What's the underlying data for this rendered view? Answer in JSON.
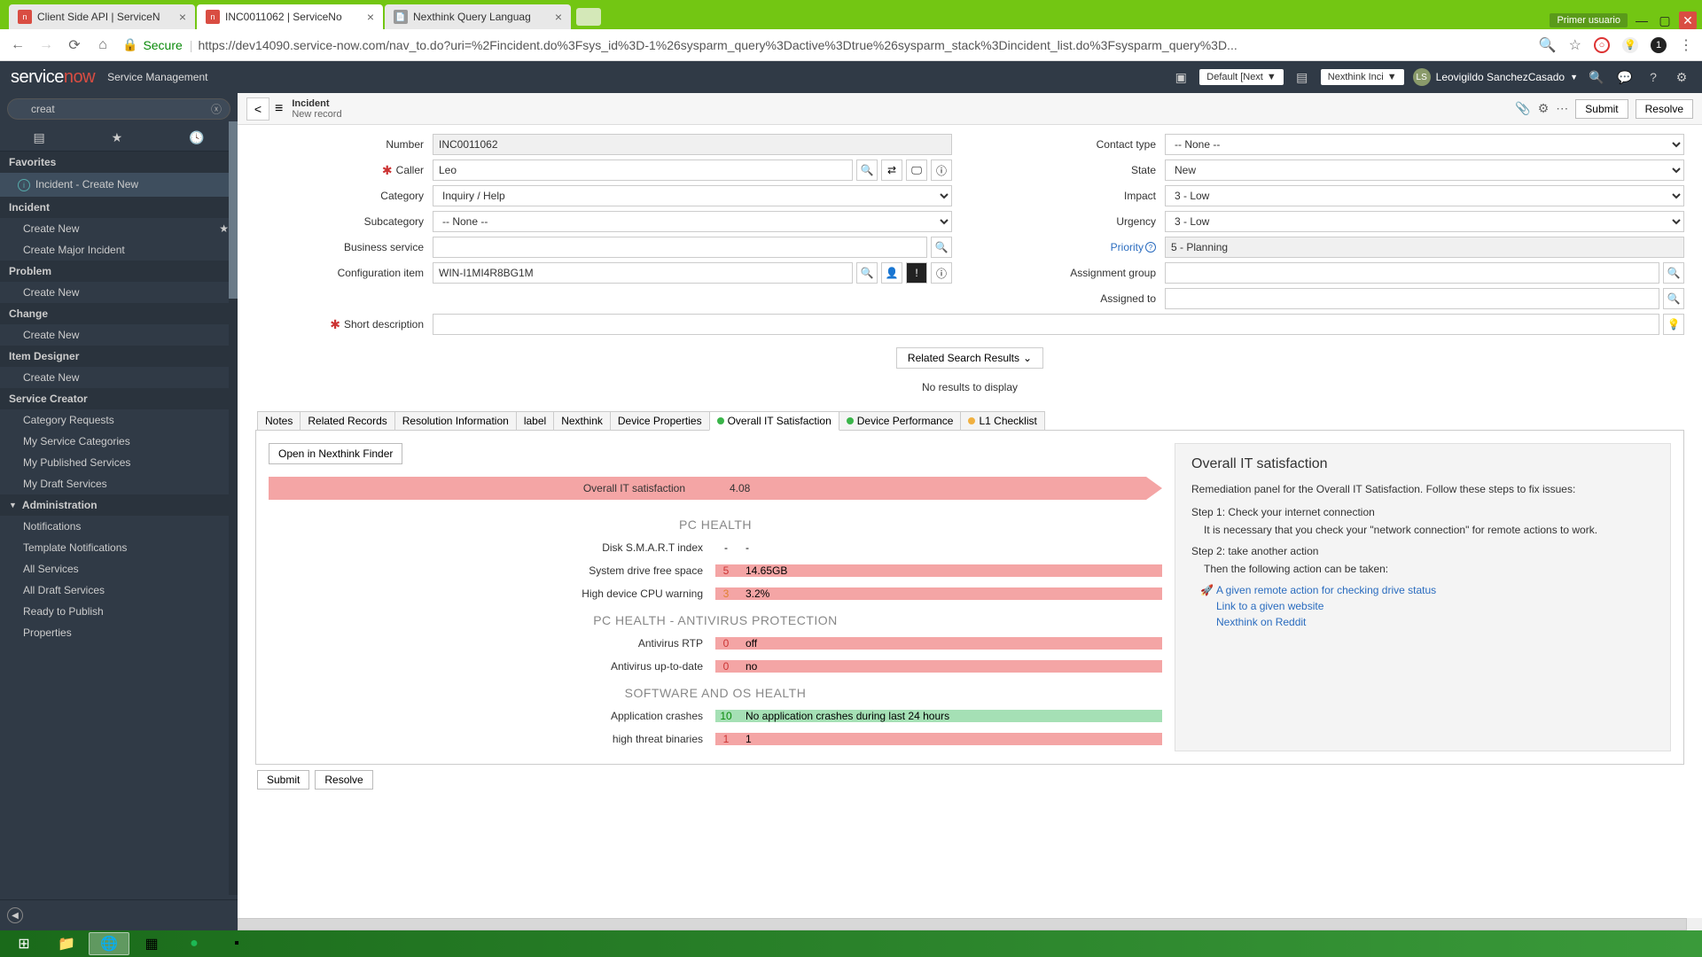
{
  "browser": {
    "tabs": [
      {
        "title": "Client Side API | ServiceN"
      },
      {
        "title": "INC0011062 | ServiceNo"
      },
      {
        "title": "Nexthink Query Languag"
      }
    ],
    "user_badge": "Primer usuario",
    "url_secure": "Secure",
    "url": "https://dev14090.service-now.com/nav_to.do?uri=%2Fincident.do%3Fsys_id%3D-1%26sysparm_query%3Dactive%3Dtrue%26sysparm_stack%3Dincident_list.do%3Fsysparm_query%3D..."
  },
  "sn_header": {
    "logo_a": "service",
    "logo_b": "now",
    "subtitle": "Service Management",
    "dd1": "Default [Next",
    "dd2": "Nexthink Inci",
    "user": "Leovigildo SanchezCasado"
  },
  "sidebar": {
    "filter": "creat",
    "favorites": "Favorites",
    "incident_create_new": "Incident - Create New",
    "sections": [
      {
        "title": "Incident",
        "items": [
          "Create New",
          "Create Major Incident"
        ]
      },
      {
        "title": "Problem",
        "items": [
          "Create New"
        ]
      },
      {
        "title": "Change",
        "items": [
          "Create New"
        ]
      },
      {
        "title": "Item Designer",
        "items": [
          "Create New"
        ]
      },
      {
        "title": "Service Creator",
        "items": [
          "Category Requests",
          "My Service Categories",
          "My Published Services",
          "My Draft Services"
        ]
      }
    ],
    "admin_title": "Administration",
    "admin_items": [
      "Notifications",
      "Template Notifications",
      "All Services",
      "All Draft Services",
      "Ready to Publish",
      "Properties"
    ]
  },
  "content_header": {
    "title": "Incident",
    "subtitle": "New record",
    "submit": "Submit",
    "resolve": "Resolve"
  },
  "form": {
    "labels": {
      "number": "Number",
      "caller": "Caller",
      "category": "Category",
      "subcategory": "Subcategory",
      "business_service": "Business service",
      "configuration_item": "Configuration item",
      "contact_type": "Contact type",
      "state": "State",
      "impact": "Impact",
      "urgency": "Urgency",
      "priority": "Priority",
      "assignment_group": "Assignment group",
      "assigned_to": "Assigned to",
      "short_description": "Short description"
    },
    "values": {
      "number": "INC0011062",
      "caller": "Leo",
      "category": "Inquiry / Help",
      "subcategory": "-- None --",
      "business_service": "",
      "configuration_item": "WIN-I1MI4R8BG1M",
      "contact_type": "-- None --",
      "state": "New",
      "impact": "3 - Low",
      "urgency": "3 - Low",
      "priority": "5 - Planning",
      "assignment_group": "",
      "assigned_to": "",
      "short_description": ""
    },
    "related_search": "Related Search Results",
    "no_results": "No results to display"
  },
  "tabs": [
    "Notes",
    "Related Records",
    "Resolution Information",
    "label",
    "Nexthink",
    "Device Properties",
    "Overall IT Satisfaction",
    "Device Performance",
    "L1 Checklist"
  ],
  "satisfaction": {
    "open_finder": "Open in Nexthink Finder",
    "banner_label": "Overall IT satisfaction",
    "banner_value": "4.08",
    "sections": [
      {
        "title": "PC HEALTH",
        "metrics": [
          {
            "label": "Disk S.M.A.R.T index",
            "score": "-",
            "value": "-",
            "cls": "plain"
          },
          {
            "label": "System drive free space",
            "score": "5",
            "value": "14.65GB",
            "cls": "red"
          },
          {
            "label": "High device CPU warning",
            "score": "3",
            "value": "3.2%",
            "cls": "red orange"
          }
        ]
      },
      {
        "title": "PC HEALTH - ANTIVIRUS PROTECTION",
        "metrics": [
          {
            "label": "Antivirus RTP",
            "score": "0",
            "value": "off",
            "cls": "red"
          },
          {
            "label": "Antivirus up-to-date",
            "score": "0",
            "value": "no",
            "cls": "red"
          }
        ]
      },
      {
        "title": "SOFTWARE AND OS HEALTH",
        "metrics": [
          {
            "label": "Application crashes",
            "score": "10",
            "value": "No application crashes during last 24 hours",
            "cls": "green"
          },
          {
            "label": "high threat binaries",
            "score": "1",
            "value": "1",
            "cls": "red"
          }
        ]
      }
    ]
  },
  "remediation": {
    "title": "Overall IT satisfaction",
    "intro": "Remediation panel for the Overall IT Satisfaction. Follow these steps to fix issues:",
    "step1_head": "Step 1: Check your internet connection",
    "step1_body": "It is necessary that you check your \"network connection\" for remote actions to work.",
    "step2_head": "Step 2: take another action",
    "step2_body": "Then the following action can be taken:",
    "links": [
      "A given remote action for checking drive status",
      "Link to a given website",
      "Nexthink on Reddit"
    ]
  },
  "bottom": {
    "submit": "Submit",
    "resolve": "Resolve"
  }
}
